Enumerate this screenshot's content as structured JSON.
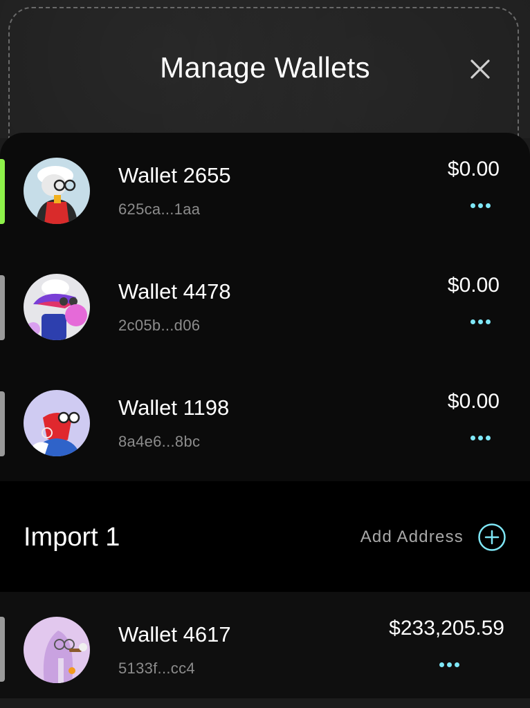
{
  "header": {
    "title": "Manage Wallets",
    "close_icon": "close-icon"
  },
  "wallets": [
    {
      "name": "Wallet 2655",
      "address": "625ca...1aa",
      "balance": "$0.00",
      "active": true
    },
    {
      "name": "Wallet 4478",
      "address": "2c05b...d06",
      "balance": "$0.00",
      "active": false
    },
    {
      "name": "Wallet 1198",
      "address": "8a4e6...8bc",
      "balance": "$0.00",
      "active": false
    }
  ],
  "import_section": {
    "title": "Import 1",
    "add_address_label": "Add Address",
    "add_icon": "plus-circle-icon"
  },
  "imported_wallets": [
    {
      "name": "Wallet 4617",
      "address": "5133f...cc4",
      "balance": "$233,205.59"
    }
  ],
  "colors": {
    "accent": "#7fe7f7",
    "active_indicator": "#8ef24a",
    "inactive_indicator": "#9a9a9a",
    "panel_bg": "#0b0b0b"
  }
}
